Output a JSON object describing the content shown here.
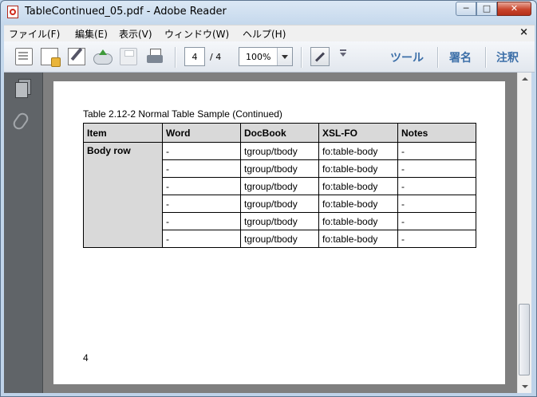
{
  "window": {
    "title": "TableContinued_05.pdf - Adobe Reader",
    "min_glyph": "─",
    "max_glyph": "□",
    "close_glyph": "✕"
  },
  "menu": {
    "items": [
      "ファイル(F)",
      "編集(E)",
      "表示(V)",
      "ウィンドウ(W)",
      "ヘルプ(H)"
    ],
    "close_glyph": "×"
  },
  "toolbar": {
    "page_current": "4",
    "page_total": "/ 4",
    "zoom": "100%",
    "tools_label": "ツール",
    "sign_label": "署名",
    "comment_label": "注釈",
    "link_color": "#3c6fa8"
  },
  "document": {
    "caption": "Table 2.12-2 Normal Table Sample (Continued)",
    "headers": [
      "Item",
      "Word",
      "DocBook",
      "XSL-FO",
      "Notes"
    ],
    "item_label": "Body row",
    "rows": [
      [
        "-",
        "tgroup/tbody",
        "fo:table-body",
        "-"
      ],
      [
        "-",
        "tgroup/tbody",
        "fo:table-body",
        "-"
      ],
      [
        "-",
        "tgroup/tbody",
        "fo:table-body",
        "-"
      ],
      [
        "-",
        "tgroup/tbody",
        "fo:table-body",
        "-"
      ],
      [
        "-",
        "tgroup/tbody",
        "fo:table-body",
        "-"
      ],
      [
        "-",
        "tgroup/tbody",
        "fo:table-body",
        "-"
      ]
    ],
    "page_number": "4"
  },
  "icons": {
    "app": "pdf-file-icon",
    "toolbar": [
      "create-pdf-icon",
      "pdf-options-icon",
      "edit-icon",
      "cloud-upload-icon",
      "save-icon",
      "print-icon",
      "fit-page-icon",
      "more-icon"
    ],
    "leftpanel": [
      "pages-icon",
      "attachment-icon"
    ]
  }
}
